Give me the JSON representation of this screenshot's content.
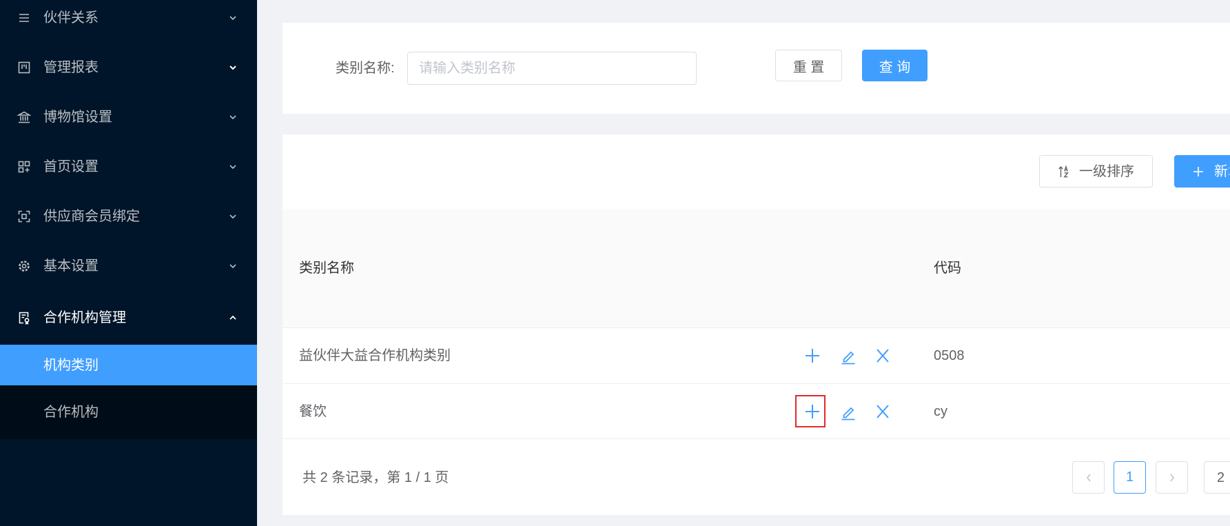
{
  "sidebar": {
    "items": [
      {
        "label": "伙伴关系",
        "icon": "menu-icon",
        "expanded": false
      },
      {
        "label": "管理报表",
        "icon": "report-icon",
        "expanded": false
      },
      {
        "label": "博物馆设置",
        "icon": "museum-icon",
        "expanded": false
      },
      {
        "label": "首页设置",
        "icon": "layout-icon",
        "expanded": false
      },
      {
        "label": "供应商会员绑定",
        "icon": "binding-icon",
        "expanded": false
      },
      {
        "label": "基本设置",
        "icon": "gear-icon",
        "expanded": false
      },
      {
        "label": "合作机构管理",
        "icon": "certificate-icon",
        "expanded": true
      }
    ],
    "submenu": [
      {
        "label": "机构类别",
        "active": true
      },
      {
        "label": "合作机构",
        "active": false
      }
    ]
  },
  "search": {
    "label": "类别名称:",
    "placeholder": "请输入类别名称",
    "value": "",
    "reset_label": "重 置",
    "query_label": "查 询"
  },
  "toolbar": {
    "sort_label": "一级排序",
    "sort_icon": "sort-alpha-icon",
    "add_label": "新增",
    "add_icon": "plus-icon"
  },
  "table": {
    "columns": [
      "类别名称",
      "代码"
    ],
    "row_actions": [
      "plus-icon",
      "edit-icon",
      "close-icon"
    ],
    "rows": [
      {
        "name": "益伙伴大益合作机构类别",
        "code": "0508"
      },
      {
        "name": "餐饮",
        "code": "cy"
      }
    ]
  },
  "pagination": {
    "summary": "共 2 条记录，第 1 / 1 页",
    "current_page": "1",
    "page_size": "2"
  },
  "colors": {
    "sidebar_bg": "#001529",
    "submenu_bg": "#000c17",
    "primary": "#409eff",
    "page_bg": "#f0f2f5",
    "highlight_box": "#e02a2a"
  }
}
